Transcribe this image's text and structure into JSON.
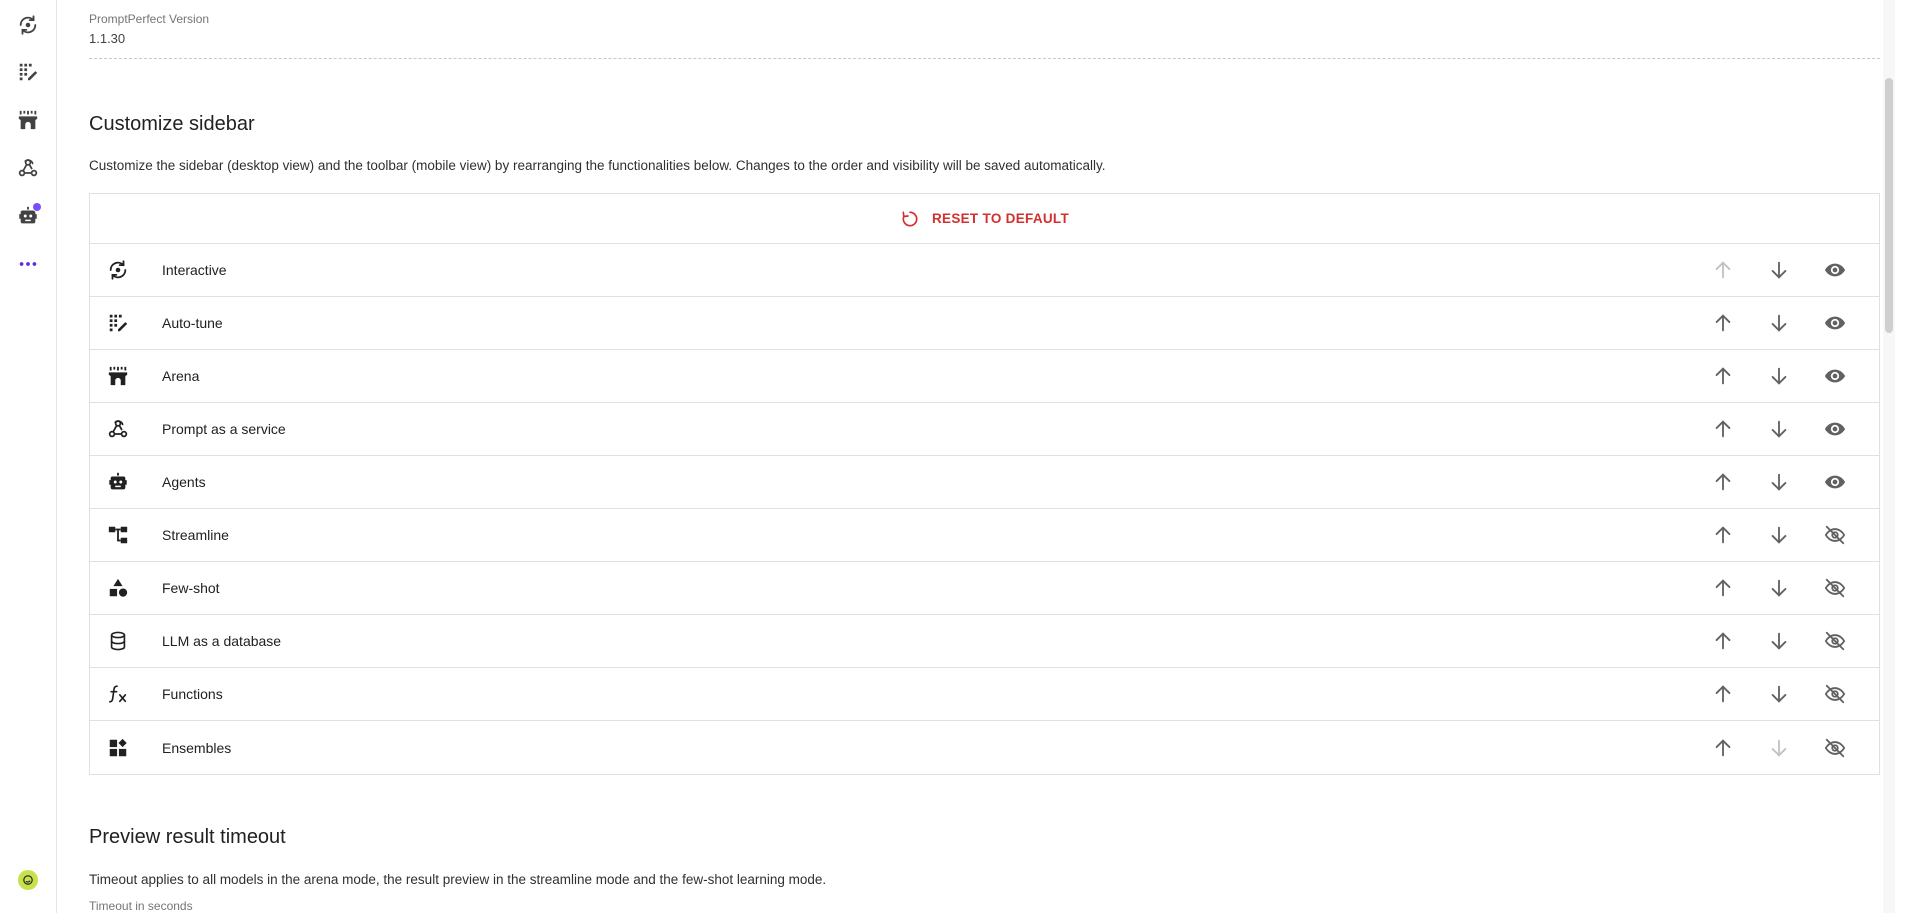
{
  "sidebar": {
    "items": [
      {
        "icon": "interactive-icon",
        "badge": false
      },
      {
        "icon": "auto-tune-icon",
        "badge": false
      },
      {
        "icon": "arena-icon",
        "badge": false
      },
      {
        "icon": "webhook-icon",
        "badge": false
      },
      {
        "icon": "agent-icon",
        "badge": true
      },
      {
        "icon": "more-dots-icon",
        "badge": false
      }
    ],
    "accent_color": "#7c4dff",
    "avatar_color": "#c6e24a"
  },
  "version": {
    "label": "PromptPerfect Version",
    "value": "1.1.30"
  },
  "customize": {
    "title": "Customize sidebar",
    "description": "Customize the sidebar (desktop view) and the toolbar (mobile view) by rearranging the functionalities below. Changes to the order and visibility will be saved automatically.",
    "reset_label": "RESET TO DEFAULT",
    "reset_color": "#d32f2f",
    "items": [
      {
        "label": "Interactive",
        "icon": "interactive-icon",
        "visible": true,
        "up_enabled": false,
        "down_enabled": true
      },
      {
        "label": "Auto-tune",
        "icon": "auto-tune-icon",
        "visible": true,
        "up_enabled": true,
        "down_enabled": true
      },
      {
        "label": "Arena",
        "icon": "arena-icon",
        "visible": true,
        "up_enabled": true,
        "down_enabled": true
      },
      {
        "label": "Prompt as a service",
        "icon": "webhook-icon",
        "visible": true,
        "up_enabled": true,
        "down_enabled": true
      },
      {
        "label": "Agents",
        "icon": "agent-icon",
        "visible": true,
        "up_enabled": true,
        "down_enabled": true
      },
      {
        "label": "Streamline",
        "icon": "streamline-icon",
        "visible": false,
        "up_enabled": true,
        "down_enabled": true
      },
      {
        "label": "Few-shot",
        "icon": "few-shot-icon",
        "visible": false,
        "up_enabled": true,
        "down_enabled": true
      },
      {
        "label": "LLM as a database",
        "icon": "database-icon",
        "visible": false,
        "up_enabled": true,
        "down_enabled": true
      },
      {
        "label": "Functions",
        "icon": "function-icon",
        "visible": false,
        "up_enabled": true,
        "down_enabled": true
      },
      {
        "label": "Ensembles",
        "icon": "ensembles-icon",
        "visible": false,
        "up_enabled": true,
        "down_enabled": false
      }
    ]
  },
  "timeout": {
    "title": "Preview result timeout",
    "description": "Timeout applies to all models in the arena mode, the result preview in the streamline mode and the few-shot learning mode.",
    "field_label": "Timeout in seconds"
  }
}
